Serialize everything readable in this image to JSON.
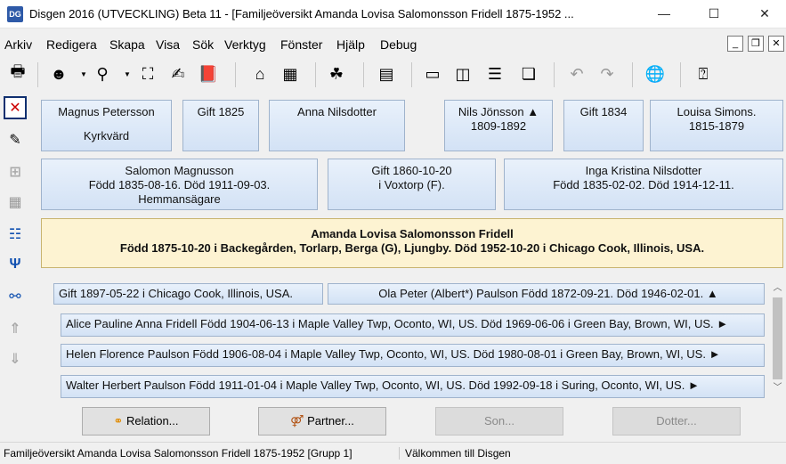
{
  "window": {
    "title": "Disgen 2016 (UTVECKLING) Beta 11 - [Familjeöversikt Amanda Lovisa Salomonsson Fridell 1875-1952 ...",
    "app_icon": "family-tree-icon",
    "minimize": "—",
    "maximize": "☐",
    "close": "✕"
  },
  "menu": [
    "Arkiv",
    "Redigera",
    "Skapa",
    "Visa",
    "Sök",
    "Verktyg",
    "Fönster",
    "Hjälp",
    "Debug"
  ],
  "mdi_controls": {
    "minimize": "_",
    "restore": "❐",
    "close": "✕"
  },
  "parents": {
    "father_side": {
      "father": {
        "name": "Magnus Petersson",
        "note": "Kyrkvärd"
      },
      "marriage": "Gift 1825",
      "mother": {
        "name": "Anna Nilsdotter"
      }
    },
    "mother_side": {
      "father": {
        "name": "Nils Jönsson ▲",
        "dates": "1809-1892"
      },
      "marriage": "Gift 1834",
      "mother": {
        "name": "Louisa Simons.",
        "dates": "1815-1879"
      }
    },
    "father": {
      "name": "Salomon Magnusson",
      "dates": "Född 1835-08-16. Död 1911-09-03.",
      "occupation": "Hemmansägare"
    },
    "marriage": {
      "date": "Gift 1860-10-20",
      "place": "i Voxtorp (F)."
    },
    "mother": {
      "name": "Inga Kristina Nilsdotter",
      "dates": "Född 1835-02-02. Död 1914-12-11."
    }
  },
  "person": {
    "name": "Amanda Lovisa Salomonsson Fridell",
    "details": "Född 1875-10-20 i Backegården, Torlarp, Berga (G), Ljungby. Död 1952-10-20 i Chicago Cook, Illinois, USA."
  },
  "spouse": {
    "marriage": "Gift 1897-05-22 i Chicago Cook, Illinois, USA.",
    "partner": "Ola Peter (Albert*) Paulson Född 1872-09-21. Död 1946-02-01. ▲"
  },
  "children": [
    "Alice Pauline Anna Fridell Född 1904-06-13 i Maple Valley Twp, Oconto, WI, US. Död 1969-06-06 i Green Bay, Brown, WI, US. ►",
    "Helen Florence Paulson Född 1906-08-04 i Maple Valley Twp, Oconto, WI, US. Död 1980-08-01 i Green Bay, Brown, WI, US. ►",
    "Walter Herbert Paulson Född 1911-01-04 i Maple Valley Twp, Oconto, WI, US. Död 1992-09-18 i Suring, Oconto, WI, US. ►"
  ],
  "buttons": {
    "relation": "Relation...",
    "partner": "Partner...",
    "son": "Son...",
    "daughter": "Dotter..."
  },
  "status": {
    "left": "Familjeöversikt Amanda Lovisa Salomonsson Fridell 1875-1952 [Grupp 1]",
    "right": "Välkommen till Disgen"
  }
}
